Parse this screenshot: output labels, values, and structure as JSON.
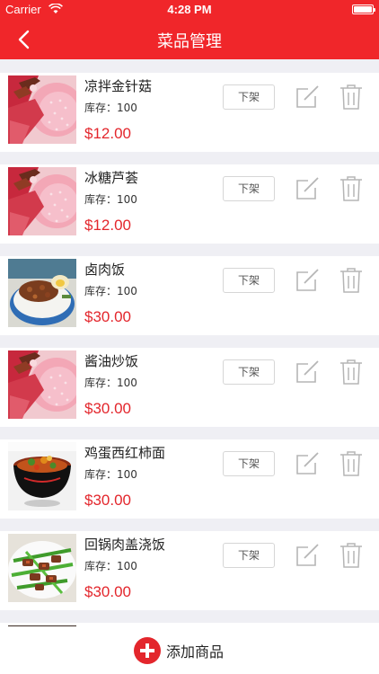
{
  "statusbar": {
    "carrier": "Carrier",
    "time": "4:28 PM"
  },
  "navbar": {
    "title": "菜品管理"
  },
  "colors": {
    "brand": "#f0262a",
    "price": "#e3262c"
  },
  "items": [
    {
      "name": "凉拌金针菇",
      "stock": "库存：100",
      "price": "$12.00",
      "action": "下架",
      "image": "strawberry-dessert"
    },
    {
      "name": "冰糖芦荟",
      "stock": "库存：100",
      "price": "$12.00",
      "action": "下架",
      "image": "strawberry-dessert"
    },
    {
      "name": "卤肉饭",
      "stock": "库存：100",
      "price": "$30.00",
      "action": "下架",
      "image": "braised-pork-rice"
    },
    {
      "name": "酱油炒饭",
      "stock": "库存：100",
      "price": "$30.00",
      "action": "下架",
      "image": "strawberry-dessert"
    },
    {
      "name": "鸡蛋西红柿面",
      "stock": "库存：100",
      "price": "$30.00",
      "action": "下架",
      "image": "noodle-bowl"
    },
    {
      "name": "回锅肉盖浇饭",
      "stock": "库存：100",
      "price": "$30.00",
      "action": "下架",
      "image": "stir-fry-plate"
    }
  ],
  "icons": {
    "back": "chevron-left-icon",
    "edit": "edit-icon",
    "delete": "trash-icon",
    "add": "plus-circle-icon"
  },
  "footer": {
    "add_label": "添加商品"
  }
}
